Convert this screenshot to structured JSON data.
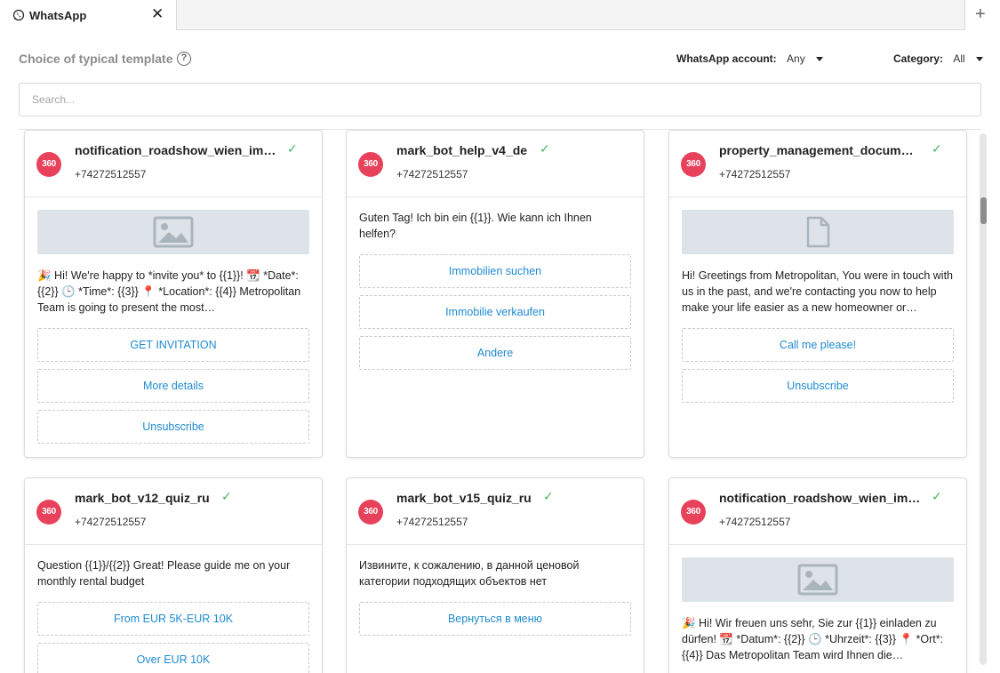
{
  "tab": {
    "title": "WhatsApp",
    "close": "✕",
    "add": "+"
  },
  "header": {
    "title": "Choice of typical template",
    "help": "?",
    "account_label": "WhatsApp account:",
    "account_value": "Any",
    "category_label": "Category:",
    "category_value": "All"
  },
  "search": {
    "placeholder": "Search..."
  },
  "logo_text": "360",
  "cards": [
    {
      "name": "notification_roadshow_wien_im…",
      "phone": "+74272512557",
      "media": "image",
      "message": "🎉 Hi! We're happy to *invite you* to {{1}}! 📆 *Date*: {{2}} 🕒 *Time*: {{3}} 📍 *Location*: {{4}} Metropolitan Team is going to present the most…",
      "buttons": [
        "GET INVITATION",
        "More details",
        "Unsubscribe"
      ]
    },
    {
      "name": "mark_bot_help_v4_de",
      "phone": "+74272512557",
      "media": "",
      "message": "Guten Tag! Ich bin ein {{1}}. Wie kann ich Ihnen helfen?",
      "buttons": [
        "Immobilien suchen",
        "Immobilie verkaufen",
        "Andere"
      ]
    },
    {
      "name": "property_management_docum…",
      "phone": "+74272512557",
      "media": "document",
      "message": "Hi! Greetings from Metropolitan, You were in touch with us in the past, and we're contacting you now to help make your life easier as a new homeowner or…",
      "buttons": [
        "Call me please!",
        "Unsubscribe"
      ]
    },
    {
      "name": "mark_bot_v12_quiz_ru",
      "phone": "+74272512557",
      "media": "",
      "message": "Question {{1}}/{{2}} Great! Please guide me on your monthly rental budget",
      "buttons": [
        "From EUR 5K-EUR 10K",
        "Over EUR 10K"
      ]
    },
    {
      "name": "mark_bot_v15_quiz_ru",
      "phone": "+74272512557",
      "media": "",
      "message": "Извините, к сожалению, в данной ценовой категории подходящих объектов нет",
      "buttons": [
        "Вернуться в меню"
      ]
    },
    {
      "name": "notification_roadshow_wien_im…",
      "phone": "+74272512557",
      "media": "image",
      "message": "🎉 Hi! Wir freuen uns sehr, Sie zur {{1}} einladen zu dürfen! 📆 *Datum*: {{2}} 🕒 *Uhrzeit*: {{3}} 📍 *Ort*: {{4}} Das Metropolitan Team wird Ihnen die…",
      "buttons": []
    }
  ],
  "colors": {
    "accent_link": "#1f8bd1",
    "check": "#43b55a",
    "logo_bg": "#e8415b",
    "media_bg": "#dde3e8"
  }
}
